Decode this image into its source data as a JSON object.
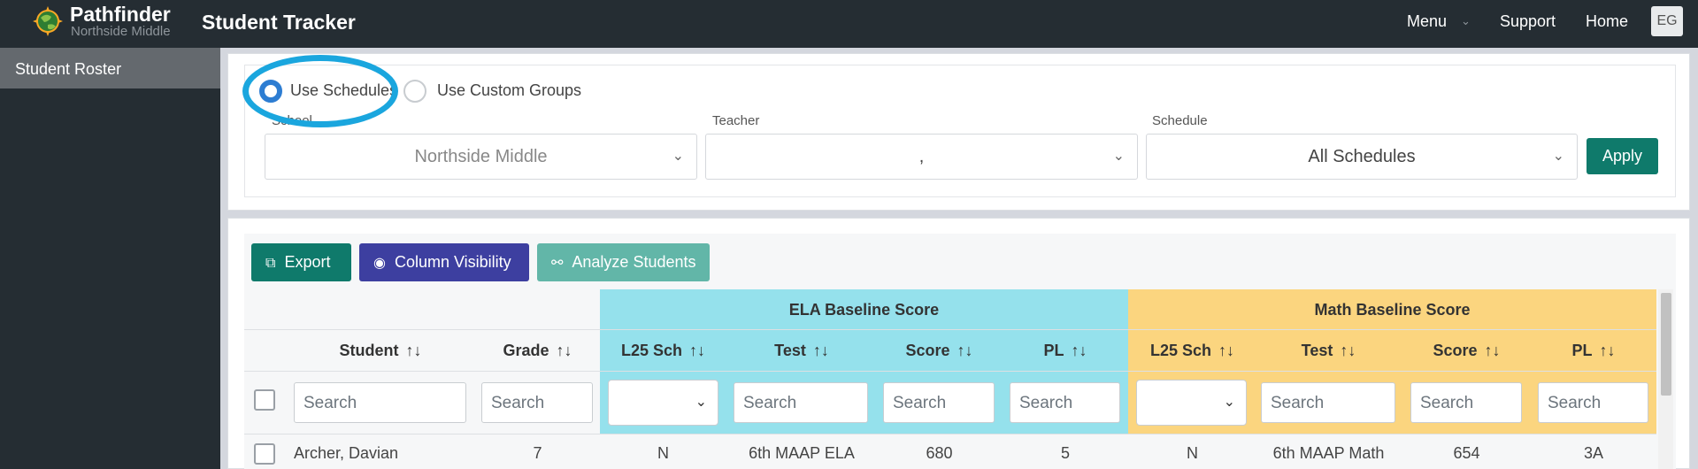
{
  "header": {
    "brand": "Pathfinder",
    "brand_sub": "Northside Middle",
    "app_title": "Student Tracker",
    "nav": {
      "menu": "Menu",
      "support": "Support",
      "home": "Home"
    },
    "avatar": "EG"
  },
  "sidebar": {
    "items": [
      {
        "label": "Student Roster",
        "active": true
      }
    ]
  },
  "filters": {
    "radio_schedules": "Use Schedules",
    "radio_custom": "Use Custom Groups",
    "selected": "Use Schedules",
    "school_label": "School",
    "school_value": "Northside Middle",
    "teacher_label": "Teacher",
    "teacher_value": ",",
    "schedule_label": "Schedule",
    "schedule_value": "All Schedules",
    "apply": "Apply"
  },
  "toolbar": {
    "export": "Export",
    "column_visibility": "Column Visibility",
    "analyze": "Analyze Students"
  },
  "table": {
    "groups": {
      "ela": "ELA Baseline Score",
      "math": "Math Baseline Score"
    },
    "columns": {
      "student": "Student",
      "grade": "Grade",
      "ela_l25": "L25 Sch",
      "ela_test": "Test",
      "ela_score": "Score",
      "ela_pl": "PL",
      "math_l25": "L25 Sch",
      "math_test": "Test",
      "math_score": "Score",
      "math_pl": "PL"
    },
    "search_placeholder": "Search",
    "rows": [
      {
        "student": "Archer, Davian",
        "grade": "7",
        "ela_l25": "N",
        "ela_test": "6th MAAP ELA",
        "ela_score": "680",
        "ela_pl": "5",
        "math_l25": "N",
        "math_test": "6th MAAP Math",
        "math_score": "654",
        "math_pl": "3A"
      }
    ]
  },
  "colors": {
    "topbar": "#252d33",
    "teal": "#0f7a6b",
    "indigo": "#3d3fa0",
    "ela_band": "#95e1ec",
    "math_band": "#fbd57f",
    "highlight": "#1aa6de"
  }
}
